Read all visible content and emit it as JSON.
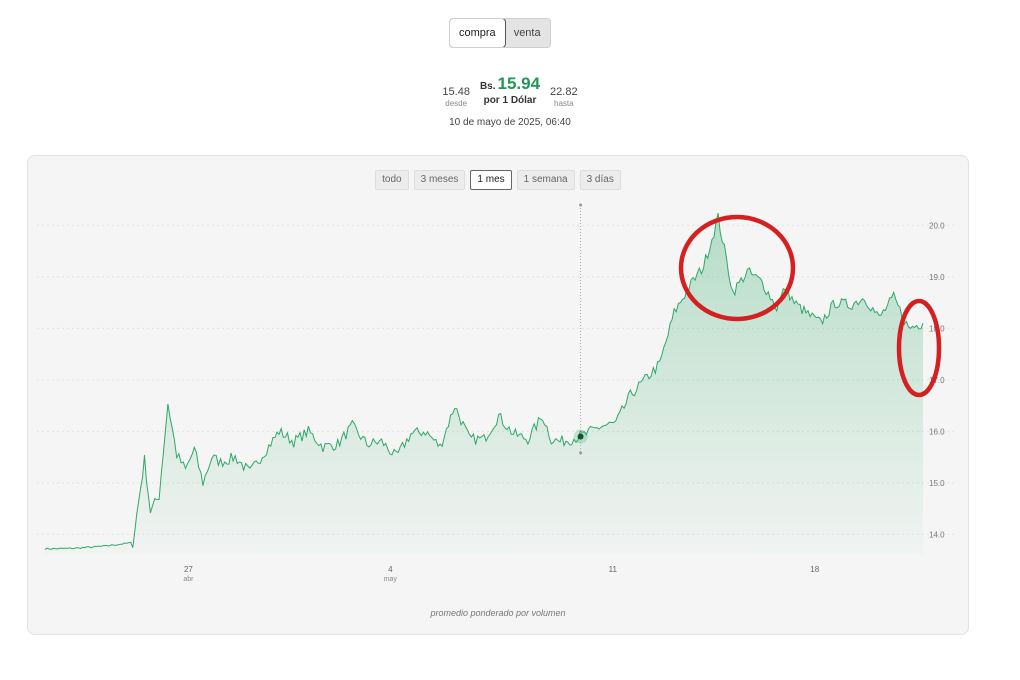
{
  "toggle": {
    "options": [
      "compra",
      "venta"
    ],
    "selected": "compra"
  },
  "rate": {
    "low_value": "15.48",
    "low_label": "desde",
    "currency": "Bs.",
    "price": "15.94",
    "per_unit": "por 1 Dólar",
    "high_value": "22.82",
    "high_label": "hasta"
  },
  "timestamp": "10 de mayo de 2025, 06:40",
  "range_buttons": [
    "todo",
    "3 meses",
    "1 mes",
    "1 semana",
    "3 días"
  ],
  "range_selected": "1 mes",
  "footnote": "promedio ponderado por volumen",
  "colors": {
    "line": "#2ea866",
    "price": "#1e9a55",
    "annotation": "#d42020"
  },
  "chart_data": {
    "type": "area",
    "title": "",
    "xlabel": "",
    "ylabel": "",
    "y_ticks": [
      "20.0",
      "19.0",
      "18.0",
      "17.0",
      "16.0",
      "15.0",
      "14.0"
    ],
    "ylim": [
      13.6,
      20.2
    ],
    "x_ticks": [
      {
        "day": "27",
        "month": "abr"
      },
      {
        "day": "4",
        "month": "may"
      },
      {
        "day": "11",
        "month": ""
      },
      {
        "day": "18",
        "month": ""
      }
    ],
    "grid": true,
    "hover_marker_date": "10 de mayo de 2025, 06:40",
    "series": [
      {
        "t": [
          0,
          1,
          2,
          3,
          3.4,
          3.6,
          3.9,
          4.2,
          4.5,
          4.8,
          5.1,
          5.4,
          5.7,
          6,
          6.5,
          7,
          7.5,
          8,
          8.5,
          9,
          9.5,
          10,
          10.5,
          11,
          11.5,
          12,
          12.5,
          13,
          13.5,
          14,
          14.5,
          15,
          15.5,
          16,
          16.5,
          17,
          17.3,
          17.6,
          18,
          18.5,
          19,
          19.5,
          20,
          20.5,
          21,
          21.5,
          22,
          22.5,
          23,
          23.5,
          24,
          24.5,
          25,
          25.3,
          25.6,
          26,
          26.5,
          27,
          27.5,
          28,
          28.5,
          29,
          29.5,
          30
        ],
        "values": [
          13.72,
          13.73,
          13.77,
          13.84,
          15.45,
          14.45,
          14.75,
          16.55,
          15.55,
          15.25,
          15.65,
          15.0,
          15.5,
          15.4,
          15.5,
          15.2,
          15.6,
          16.0,
          15.8,
          16.0,
          15.7,
          15.75,
          16.1,
          15.75,
          15.8,
          15.5,
          15.95,
          16.0,
          15.7,
          16.5,
          15.85,
          15.85,
          16.3,
          15.95,
          15.85,
          16.3,
          15.85,
          15.8,
          15.85,
          15.95,
          16.1,
          16.15,
          16.7,
          17.0,
          17.3,
          18.3,
          18.8,
          19.2,
          20.15,
          18.7,
          19.1,
          18.9,
          18.4,
          18.8,
          18.5,
          18.3,
          18.1,
          18.5,
          18.45,
          18.6,
          18.2,
          18.6,
          18.0,
          18.1
        ]
      }
    ]
  }
}
